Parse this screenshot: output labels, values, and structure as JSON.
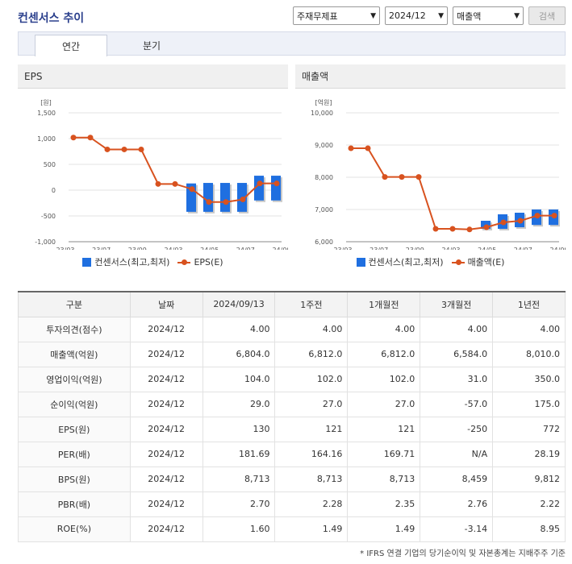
{
  "title": "컨센서스 추이",
  "controls": {
    "select1": "주재무제표",
    "select2": "2024/12",
    "select3": "매출액",
    "search": "검색"
  },
  "tabs": {
    "annual": "연간",
    "quarter": "분기"
  },
  "panels": {
    "left": "EPS",
    "right": "매출액"
  },
  "legend": {
    "bar": "컨센서스(최고,최저)",
    "line_left": "EPS(E)",
    "line_right": "매출액(E)"
  },
  "chart_data": [
    {
      "type": "bar",
      "title": "EPS",
      "ylabel": "[원]",
      "ylim": [
        -1000,
        1500
      ],
      "yticks": [
        "1,500",
        "1,000",
        "500",
        "0",
        "-500",
        "-1,000"
      ],
      "xticks": [
        "23/03",
        "23/07",
        "23/09",
        "24/03",
        "24/05",
        "24/07",
        "24/09"
      ],
      "line": {
        "name": "EPS(E)",
        "values": [
          1020,
          1020,
          790,
          790,
          790,
          120,
          120,
          20,
          -230,
          -230,
          -180,
          130,
          130
        ]
      },
      "bars": [
        {
          "index": 7,
          "low": -420,
          "high": 130
        },
        {
          "index": 8,
          "low": -420,
          "high": 140
        },
        {
          "index": 9,
          "low": -420,
          "high": 140
        },
        {
          "index": 10,
          "low": -420,
          "high": 140
        },
        {
          "index": 11,
          "low": -200,
          "high": 280
        },
        {
          "index": 12,
          "low": -200,
          "high": 280
        }
      ]
    },
    {
      "type": "bar",
      "title": "매출액",
      "ylabel": "[억원]",
      "ylim": [
        6000,
        10000
      ],
      "yticks": [
        "10,000",
        "9,000",
        "8,000",
        "7,000",
        "6,000"
      ],
      "xticks": [
        "23/03",
        "23/07",
        "23/09",
        "24/03",
        "24/05",
        "24/07",
        "24/09"
      ],
      "line": {
        "name": "매출액(E)",
        "values": [
          8900,
          8900,
          8010,
          8010,
          8010,
          6400,
          6400,
          6380,
          6450,
          6600,
          6650,
          6810,
          6810
        ]
      },
      "bars": [
        {
          "index": 8,
          "low": 6400,
          "high": 6650
        },
        {
          "index": 9,
          "low": 6400,
          "high": 6850
        },
        {
          "index": 10,
          "low": 6450,
          "high": 6900
        },
        {
          "index": 11,
          "low": 6520,
          "high": 7000
        },
        {
          "index": 12,
          "low": 6520,
          "high": 7000
        }
      ]
    }
  ],
  "table": {
    "headers": [
      "구분",
      "날짜",
      "2024/09/13",
      "1주전",
      "1개월전",
      "3개월전",
      "1년전"
    ],
    "rows": [
      [
        "투자의견(점수)",
        "2024/12",
        "4.00",
        "4.00",
        "4.00",
        "4.00",
        "4.00"
      ],
      [
        "매출액(억원)",
        "2024/12",
        "6,804.0",
        "6,812.0",
        "6,812.0",
        "6,584.0",
        "8,010.0"
      ],
      [
        "영업이익(억원)",
        "2024/12",
        "104.0",
        "102.0",
        "102.0",
        "31.0",
        "350.0"
      ],
      [
        "순이익(억원)",
        "2024/12",
        "29.0",
        "27.0",
        "27.0",
        "-57.0",
        "175.0"
      ],
      [
        "EPS(원)",
        "2024/12",
        "130",
        "121",
        "121",
        "-250",
        "772"
      ],
      [
        "PER(배)",
        "2024/12",
        "181.69",
        "164.16",
        "169.71",
        "N/A",
        "28.19"
      ],
      [
        "BPS(원)",
        "2024/12",
        "8,713",
        "8,713",
        "8,713",
        "8,459",
        "9,812"
      ],
      [
        "PBR(배)",
        "2024/12",
        "2.70",
        "2.28",
        "2.35",
        "2.76",
        "2.22"
      ],
      [
        "ROE(%)",
        "2024/12",
        "1.60",
        "1.49",
        "1.49",
        "-3.14",
        "8.95"
      ]
    ]
  },
  "footnote": "* IFRS 연결 기업의 당기순이익 및 자본총계는 지배주주 기준"
}
